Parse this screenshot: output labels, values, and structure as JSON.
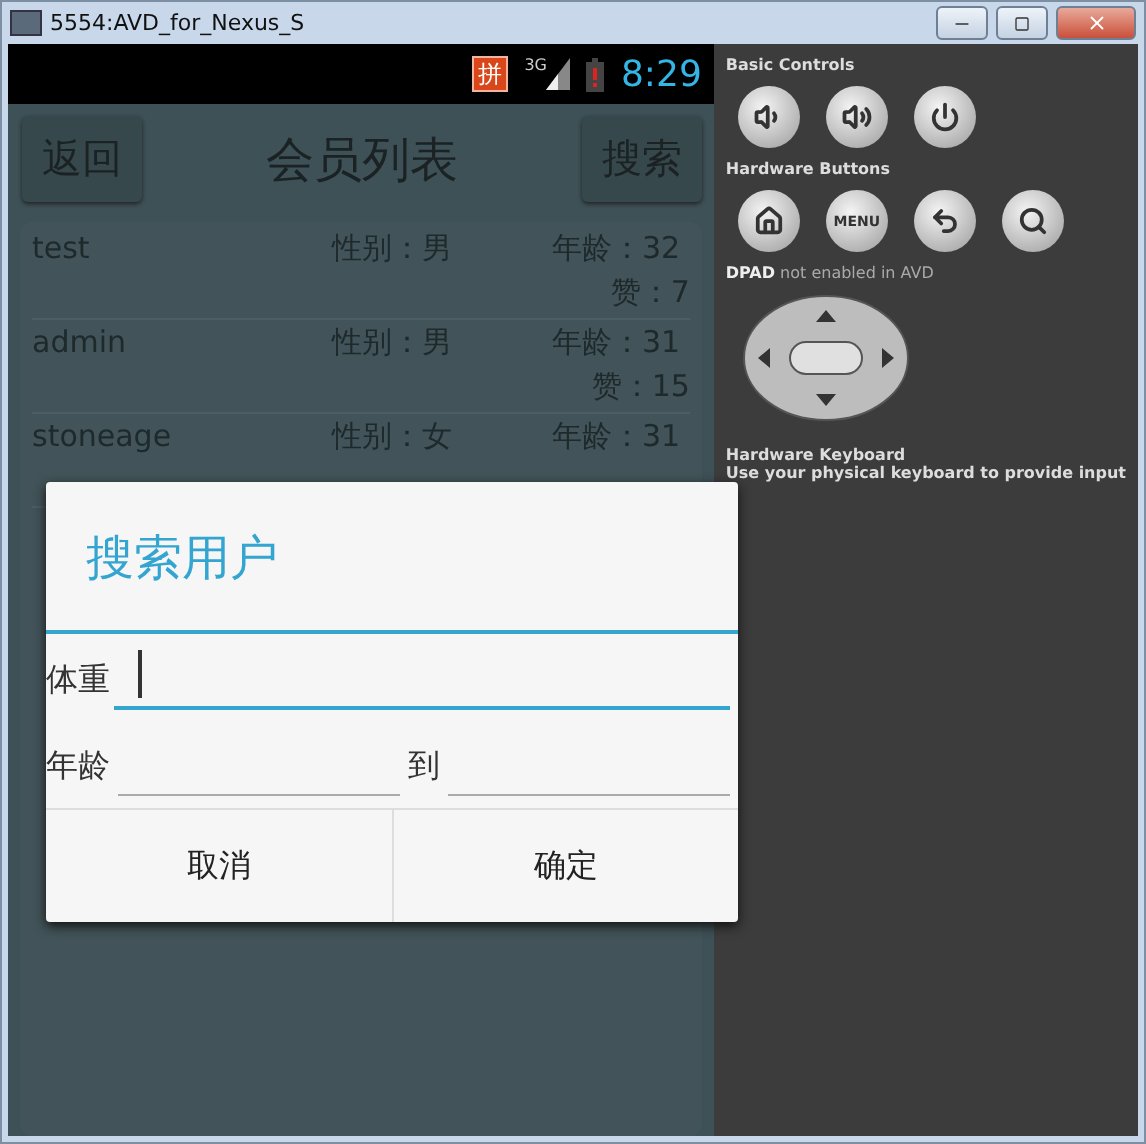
{
  "window": {
    "title": "5554:AVD_for_Nexus_S"
  },
  "status_bar": {
    "ime": "拼",
    "network": "3G",
    "time": "8:29"
  },
  "app_bar": {
    "back_button": "返回",
    "title": "会员列表",
    "search_button": "搜索"
  },
  "members": [
    {
      "name": "test",
      "gender": "性别：男",
      "age": "年龄：32",
      "likes": "赞：7"
    },
    {
      "name": "admin",
      "gender": "性别：男",
      "age": "年龄：31",
      "likes": "赞：15"
    },
    {
      "name": "stoneage",
      "gender": "性别：女",
      "age": "年龄：31"
    }
  ],
  "dialog": {
    "title": "搜索用户",
    "weight": {
      "label": "体重",
      "focused": true
    },
    "age_range": {
      "label": "年龄",
      "separator": "到",
      "focused": false
    },
    "buttons": [
      "取消",
      "确定"
    ]
  },
  "controls": {
    "basic_label": "Basic Controls",
    "hardware_label": "Hardware Buttons",
    "menu": "MENU",
    "dpad_note": "**DPAD** not enabled in AVD",
    "keyboard_title": "Hardware Keyboard",
    "keyboard_note": "Use your physical keyboard to provide input"
  }
}
